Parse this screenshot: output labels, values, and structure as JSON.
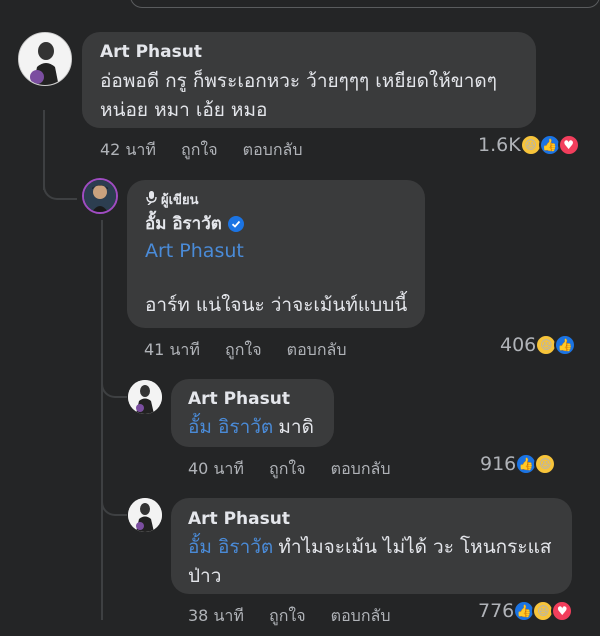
{
  "comments": [
    {
      "author": "Art Phasut",
      "text_line1": "อ่อพอดี กรู ก็พระเอกหวะ ว้ายๆๆๆ เหยียดให้ขาดๆ",
      "text_line2": "หน่อย หมา เอ้ย หมอ",
      "time": "42 นาที",
      "like_label": "ถูกใจ",
      "reply_label": "ตอบกลับ",
      "reaction_count": "1.6K",
      "reactions": [
        "haha-icon",
        "like-icon",
        "love-icon"
      ]
    },
    {
      "author_badge": "ผู้เขียน",
      "author": "อั้ม อิราวัต",
      "mention": "Art Phasut",
      "text": "อาร์ท แน่ใจนะ ว่าจะเม้นท์แบบนี้",
      "time": "41 นาที",
      "like_label": "ถูกใจ",
      "reply_label": "ตอบกลับ",
      "reaction_count": "406",
      "reactions": [
        "haha-icon",
        "like-icon"
      ]
    },
    {
      "author": "Art Phasut",
      "mention": "อั้ม อิราวัต",
      "text": "มาดิ",
      "time": "40 นาที",
      "like_label": "ถูกใจ",
      "reply_label": "ตอบกลับ",
      "reaction_count": "916",
      "reactions": [
        "like-icon",
        "haha-icon"
      ]
    },
    {
      "author": "Art Phasut",
      "mention": "อั้ม อิราวัต",
      "text_line1": "ทำไมจะเม้น ไม่ได้ วะ โหนกระแส",
      "text_line2": "ป่าว",
      "time": "38 นาที",
      "like_label": "ถูกใจ",
      "reply_label": "ตอบกลับ",
      "reaction_count": "776",
      "reactions": [
        "like-icon",
        "haha-icon",
        "love-icon"
      ]
    }
  ],
  "colors": {
    "background": "#242526",
    "bubble": "#3a3b3c",
    "mention": "#4a8bd8",
    "verified": "#1b74e4"
  }
}
